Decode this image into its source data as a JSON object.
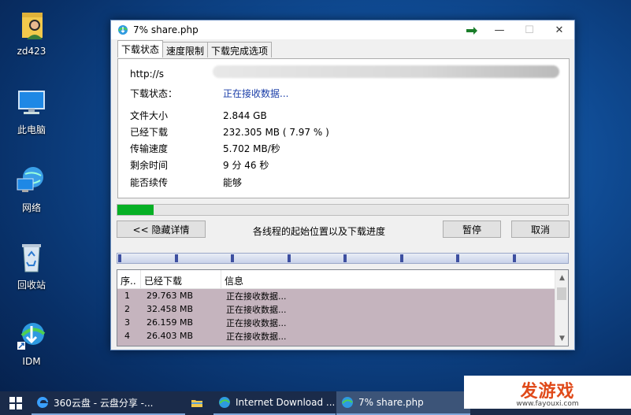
{
  "desktop": {
    "icons": [
      {
        "label": "zd423"
      },
      {
        "label": "此电脑"
      },
      {
        "label": "网络"
      },
      {
        "label": "回收站"
      },
      {
        "label": "IDM"
      }
    ]
  },
  "window": {
    "title": "7% share.php",
    "tabs": [
      "下载状态",
      "速度限制",
      "下载完成选项"
    ],
    "url_prefix": "http://s",
    "status_label": "下载状态：",
    "status_value": "正在接收数据...",
    "fields": [
      {
        "key": "文件大小",
        "value": "2.844  GB"
      },
      {
        "key": "已经下载",
        "value": "232.305  MB  ( 7.97 % )"
      },
      {
        "key": "传输速度",
        "value": "5.702  MB/秒"
      },
      {
        "key": "剩余时间",
        "value": "9 分 46 秒"
      },
      {
        "key": "能否续传",
        "value": "能够"
      }
    ],
    "progress_fraction": 0.0797,
    "hide_details_button": "<< 隐藏详情",
    "threads_label": "各线程的起始位置以及下载进度",
    "pause_button": "暂停",
    "cancel_button": "取消",
    "list_headers": [
      "序..",
      "已经下载",
      "信息"
    ],
    "list_rows": [
      {
        "n": "1",
        "size": "29.763  MB",
        "info": "正在接收数据..."
      },
      {
        "n": "2",
        "size": "32.458  MB",
        "info": "正在接收数据..."
      },
      {
        "n": "3",
        "size": "26.159  MB",
        "info": "正在接收数据..."
      },
      {
        "n": "4",
        "size": "26.403  MB",
        "info": "正在接收数据..."
      }
    ],
    "progress_color": "#06b025"
  },
  "taskbar": {
    "items": [
      {
        "label": "360云盘 - 云盘分享 -...",
        "icon": "edge-icon"
      },
      {
        "label": "",
        "icon": "folder-icon"
      },
      {
        "label": "Internet Download ...",
        "icon": "idm-icon"
      },
      {
        "label": "7% share.php",
        "icon": "idm-icon"
      }
    ]
  },
  "watermark": {
    "title": "发游戏",
    "url": "www.fayouxi.com"
  }
}
